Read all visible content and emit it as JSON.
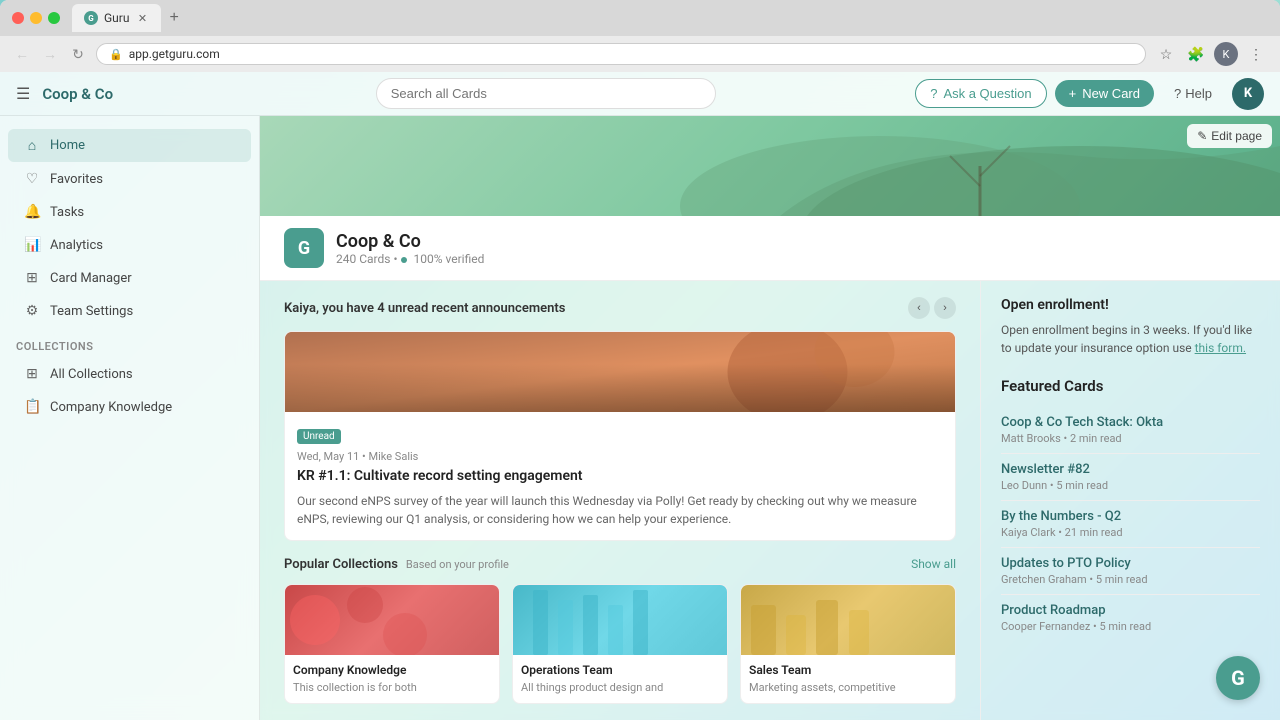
{
  "browser": {
    "url": "app.getguru.com",
    "tab_label": "Guru",
    "tab_favicon": "G"
  },
  "topnav": {
    "hamburger": "☰",
    "logo": "Coop & Co",
    "search_placeholder": "Search all Cards",
    "ask_label": "Ask a Question",
    "new_card_label": "New Card",
    "help_label": "Help",
    "user_initial": "K"
  },
  "sidebar": {
    "nav_items": [
      {
        "id": "home",
        "label": "Home",
        "icon": "⌂",
        "active": true
      },
      {
        "id": "favorites",
        "label": "Favorites",
        "icon": "♡"
      },
      {
        "id": "tasks",
        "label": "Tasks",
        "icon": "🔔"
      },
      {
        "id": "analytics",
        "label": "Analytics",
        "icon": "📊"
      },
      {
        "id": "card-manager",
        "label": "Card Manager",
        "icon": "⊞"
      },
      {
        "id": "team-settings",
        "label": "Team Settings",
        "icon": "⚙"
      }
    ],
    "collections_label": "Collections",
    "collection_items": [
      {
        "id": "all-collections",
        "label": "All Collections",
        "icon": "⊞"
      },
      {
        "id": "company-knowledge",
        "label": "Company Knowledge",
        "icon": "📋"
      }
    ]
  },
  "company": {
    "name": "Coop & Co",
    "logo_letter": "G",
    "cards_count": "240 Cards",
    "verified_label": "100% verified",
    "separator": "•",
    "edit_page": "Edit page"
  },
  "announcements": {
    "section_title": "Kaiya, you have 4 unread recent announcements",
    "badge": "Unread",
    "meta": "Wed, May 11 • Mike Salis",
    "title": "KR #1.1: Cultivate record setting engagement",
    "body": "Our second eNPS survey of the year will launch this Wednesday via Polly! Get ready by checking out why we measure eNPS, reviewing our Q1 analysis, or considering how we can help your experience."
  },
  "popular_collections": {
    "title": "Popular Collections",
    "subtitle": "Based on your profile",
    "show_all": "Show all",
    "items": [
      {
        "name": "Company Knowledge",
        "desc": "This collection is for both",
        "thumb_class": "thumb-1"
      },
      {
        "name": "Operations Team",
        "desc": "All things product design and",
        "thumb_class": "thumb-2"
      },
      {
        "name": "Sales Team",
        "desc": "Marketing assets, competitive",
        "thumb_class": "thumb-3"
      }
    ]
  },
  "right_panel": {
    "enrollment_title": "Open enrollment!",
    "enrollment_text": "Open enrollment begins in 3 weeks. If you'd like to update your insurance option use ",
    "enrollment_link_text": "this form.",
    "featured_cards_title": "Featured Cards",
    "featured_cards": [
      {
        "name": "Coop & Co Tech Stack: Okta",
        "meta": "Matt Brooks • 2 min read"
      },
      {
        "name": "Newsletter #82",
        "meta": "Leo Dunn • 5 min read"
      },
      {
        "name": "By the Numbers - Q2",
        "meta": "Kaiya Clark • 21 min read"
      },
      {
        "name": "Updates to PTO Policy",
        "meta": "Gretchen Graham • 5 min read"
      },
      {
        "name": "Product Roadmap",
        "meta": "Cooper Fernandez • 5 min read"
      }
    ]
  },
  "guru_fab": "G"
}
